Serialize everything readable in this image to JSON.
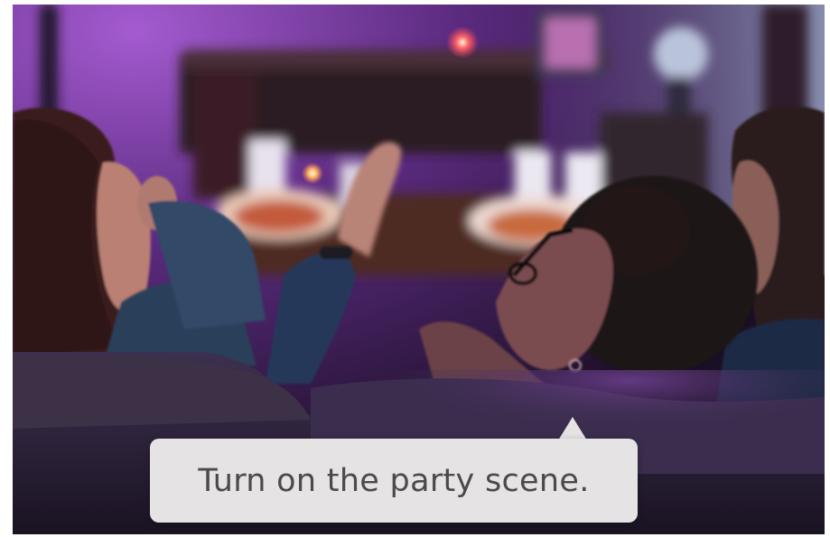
{
  "image": {
    "description_name": "friends-on-couch-photo"
  },
  "siri_prompt": {
    "text": "Turn on the party scene."
  },
  "colors": {
    "bubble_bg": "#e6e3e4",
    "bubble_text": "#4a4a4c",
    "scene_purple": "#7a2fa8",
    "scene_dark": "#1c1023"
  }
}
